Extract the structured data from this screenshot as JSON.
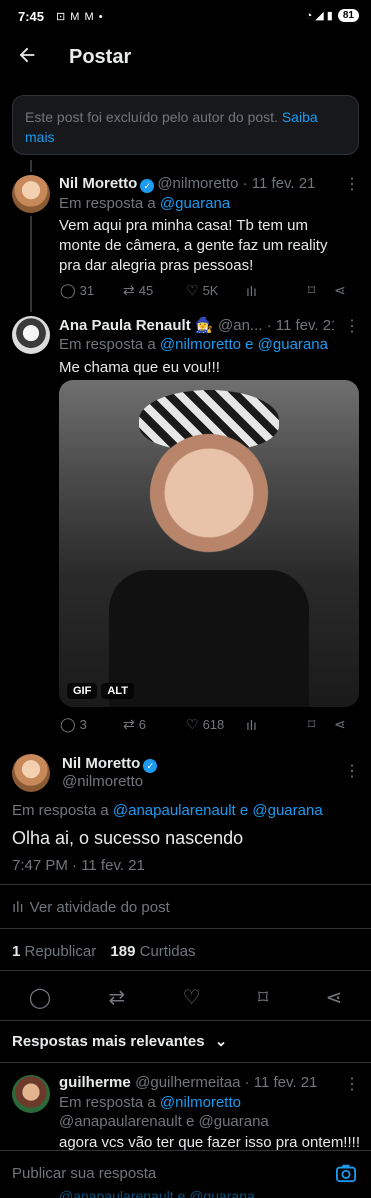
{
  "status_bar": {
    "time": "7:45",
    "left_icons": "⊡ M M •",
    "right_icons": "◔ ◢ ▮",
    "battery": "81"
  },
  "appbar": {
    "back_icon": "arrow-left-icon",
    "title": "Postar"
  },
  "deleted_notice": {
    "text": "Este post foi excluído pelo autor do post. ",
    "link": "Saiba mais"
  },
  "posts": [
    {
      "name": "Nil Moretto",
      "handle": "@nilmoretto · 11 fev. 21",
      "reply_prefix": "Em resposta a ",
      "reply_to": "@guarana",
      "text": "Vem aqui pra minha casa! Tb tem um monte de câmera, a gente faz um reality pra dar alegria pras pessoas!",
      "replies": "31",
      "reposts": "45",
      "likes": "5K"
    },
    {
      "name": "Ana Paula Renault 🧙‍♀️",
      "handle": "@an... · 11 fev. 21",
      "reply_prefix": "Em resposta a ",
      "reply_to": "@nilmoretto e @guarana",
      "text": "Me chama que eu vou!!!",
      "media_badges": [
        "GIF",
        "ALT"
      ],
      "replies": "3",
      "reposts": "6",
      "likes": "618"
    }
  ],
  "main_post": {
    "name": "Nil Moretto",
    "handle": "@nilmoretto",
    "reply_prefix": "Em resposta a ",
    "reply_to": "@anapaularenault e @guarana",
    "text": "Olha ai, o sucesso nascendo",
    "timestamp": "7:47 PM · 11 fev. 21",
    "activity": "Ver atividade do post",
    "repost_count": "1",
    "repost_label": "Republicar",
    "like_count": "189",
    "like_label": "Curtidas"
  },
  "relevant_label": "Respostas mais relevantes",
  "reply_post": {
    "name": "guilherme",
    "handle": "@guilhermeitaa · 11 fev. 21",
    "reply_prefix": "Em resposta a ",
    "reply_to_1": "@nilmoretto",
    "reply_to_2": "@anapaularenault e @guarana",
    "text": "agora vcs vão ter que fazer isso pra ontem!!!!"
  },
  "composer": {
    "placeholder": "Publicar sua resposta",
    "behind_text": "@anapaularenault e @guarana"
  }
}
